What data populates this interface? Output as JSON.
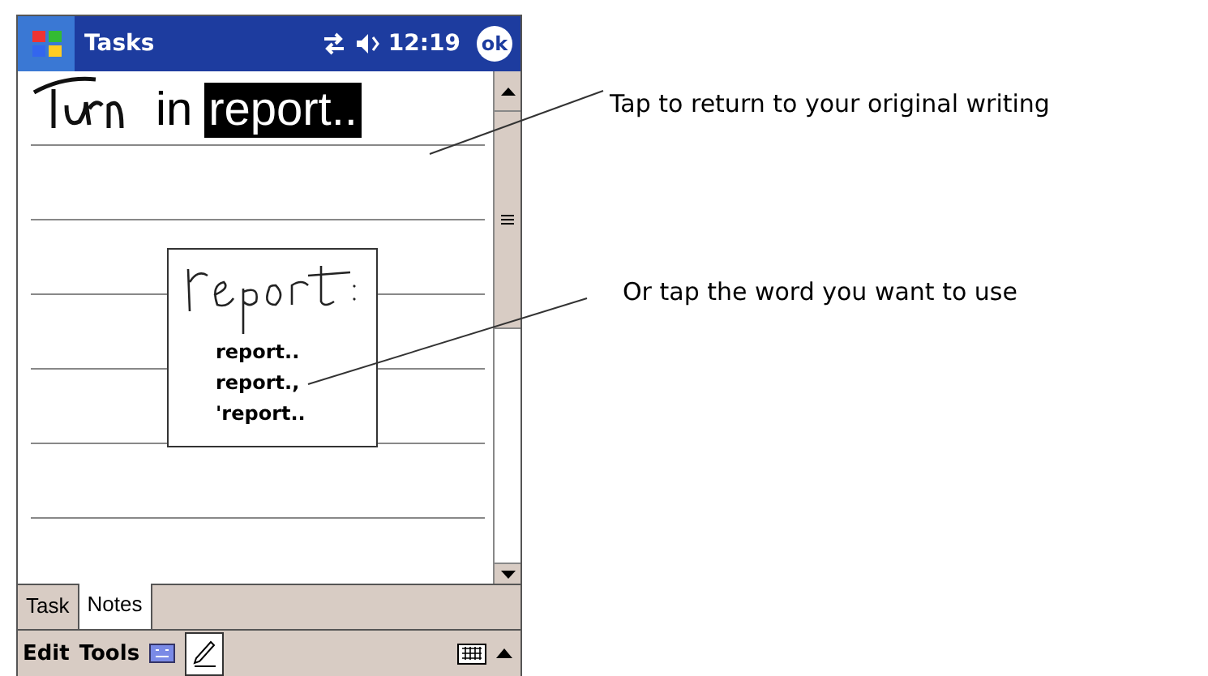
{
  "title_bar": {
    "title": "Tasks",
    "time": "12:19",
    "ok": "ok"
  },
  "note": {
    "words": [
      {
        "text": "in",
        "selected": false
      },
      {
        "text": "report..",
        "selected": true
      }
    ]
  },
  "popup": {
    "alternatives": [
      "report..",
      "report.,",
      "'report.."
    ]
  },
  "tabs": [
    {
      "label": "Task",
      "selected": false
    },
    {
      "label": "Notes",
      "selected": true
    }
  ],
  "menu": [
    "Edit",
    "Tools"
  ],
  "callouts": [
    "Tap to return to your original writing",
    "Or tap the word you want to use"
  ]
}
